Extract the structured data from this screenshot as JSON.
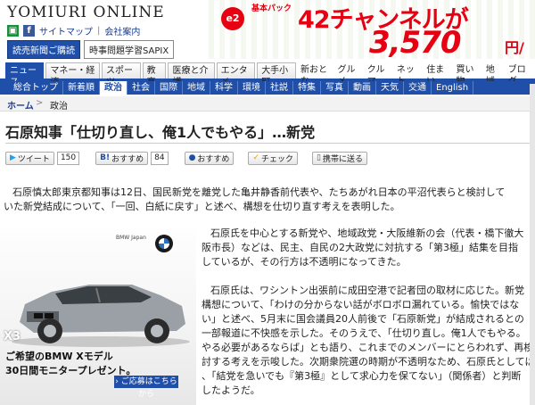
{
  "header": {
    "logo": "YOMIURI ONLINE",
    "links": [
      "サイトマップ",
      "会社案内"
    ],
    "button_primary": "読売新聞ご購読",
    "button_secondary": "時事問題学習SAPIX"
  },
  "ad_banner": {
    "logo": "e2",
    "small_text": "基本パック",
    "headline": "42チャンネルが",
    "price": "3,570",
    "unit": "円/月"
  },
  "nav_primary": [
    {
      "label": "ニュース",
      "active": true
    },
    {
      "label": "マネー・経済",
      "active": false
    },
    {
      "label": "スポーツ",
      "active": false
    },
    {
      "label": "教育",
      "active": false
    },
    {
      "label": "医療と介護",
      "active": false
    },
    {
      "label": "エンタメ",
      "active": false
    },
    {
      "label": "大手小町",
      "active": false
    },
    {
      "label": "新おとな",
      "active": false
    },
    {
      "label": "グルメ",
      "active": false
    },
    {
      "label": "クルマ",
      "active": false
    },
    {
      "label": "ネット",
      "active": false
    },
    {
      "label": "住まい",
      "active": false
    },
    {
      "label": "買い物",
      "active": false
    },
    {
      "label": "地域",
      "active": false
    },
    {
      "label": "ブログ",
      "active": false
    }
  ],
  "nav_secondary": [
    {
      "label": "総合トップ",
      "active": false
    },
    {
      "label": "新着順",
      "active": false
    },
    {
      "label": "政治",
      "active": true
    },
    {
      "label": "社会",
      "active": false
    },
    {
      "label": "国際",
      "active": false
    },
    {
      "label": "地域",
      "active": false
    },
    {
      "label": "科学",
      "active": false
    },
    {
      "label": "環境",
      "active": false
    },
    {
      "label": "社説",
      "active": false
    },
    {
      "label": "特集",
      "active": false
    },
    {
      "label": "写真",
      "active": false
    },
    {
      "label": "動画",
      "active": false
    },
    {
      "label": "天気",
      "active": false
    },
    {
      "label": "交通",
      "active": false
    },
    {
      "label": "English",
      "active": false
    }
  ],
  "breadcrumb": {
    "home": "ホーム",
    "sep": ">",
    "current": "政治"
  },
  "article": {
    "title": "石原知事「仕切り直し、俺1人でもやる」…新党",
    "share": {
      "tweet": "ツイート",
      "tweet_count": "150",
      "bookmark1": "おすすめ",
      "bookmark1_count": "84",
      "bookmark2": "おすすめ",
      "check": "チェック",
      "mobile": "携帯に送る"
    },
    "p1_line1": "石原慎太郎東京都知事は12日、国民新党を離党した亀井静香前代表や、たちあがれ日本の平沼代表らと検討して",
    "p1_line2": "いた新党結成について、「一回、白紙に戻す」と述べ、構想を仕切り直す考えを表明した。",
    "p2_lines": [
      "石原氏を中心とする新党や、地域政党・大阪維新の会（代表・橋下徹大",
      "阪市長）などは、民主、自民の2大政党に対抗する「第3極」結集を目指",
      "しているが、その行方は不透明になってきた。"
    ],
    "p3_lines": [
      "石原氏は、ワシントン出張前に成田空港で記者団の取材に応じた。新党",
      "構想について、「わけの分からない話がボロボロ漏れている。愉快ではな",
      "い」と述べ、5月末に国会議員20人前後で「石原新党」が結成されるとの",
      "一部報道に不快感を示した。そのうえで、「仕切り直し。俺1人でもやる。",
      "やる必要があるならば」とも語り、これまでのメンバーにとらわれず、再検",
      "討する考えを示唆した。次期衆院選の時期が不透明なため、石原氏としては",
      "、「結党を急いでも『第3極』として求心力を保てない」（関係者）と判断",
      "したようだ。"
    ]
  },
  "side_ad": {
    "brand_small": "BMW Japan",
    "model": "X3",
    "line1": "ご希望のBMW Xモデル",
    "line2": "30日間モニタープレゼント。",
    "button": "ご応募はこちらから"
  }
}
